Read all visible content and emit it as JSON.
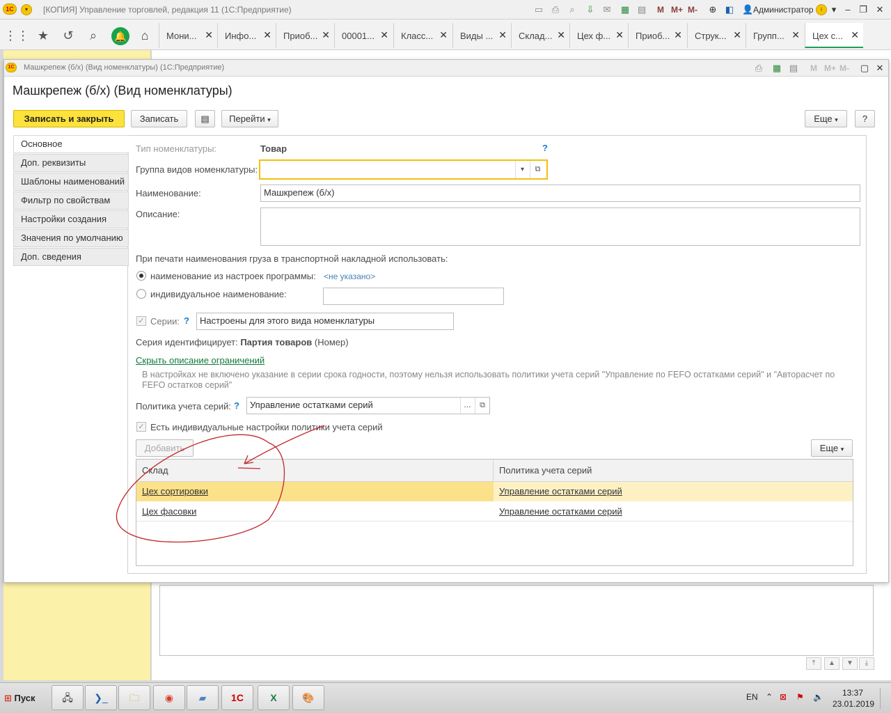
{
  "app_title": "[КОПИЯ] Управление торговлей, редакция 11  (1С:Предприятие)",
  "user": "Администратор",
  "toolbar_letters": [
    "M",
    "M+",
    "M-"
  ],
  "tabs": [
    "Мони...",
    "Инфо...",
    "Приоб...",
    "00001...",
    "Класс...",
    "Виды ...",
    "Склад...",
    "Цех ф...",
    "Приоб...",
    "Струк...",
    "Групп...",
    "Цех с..."
  ],
  "form": {
    "window_title": "Машкрепеж (б/х) (Вид номенклатуры)  (1С:Предприятие)",
    "toolbar_letters": [
      "M",
      "M+",
      "M-"
    ],
    "heading": "Машкрепеж (б/х) (Вид номенклатуры)",
    "buttons": {
      "save_close": "Записать и закрыть",
      "save": "Записать",
      "goto": "Перейти",
      "more": "Еще",
      "help": "?"
    },
    "nav": [
      "Основное",
      "Доп. реквизиты",
      "Шаблоны наименований",
      "Фильтр по свойствам",
      "Настройки создания",
      "Значения по умолчанию",
      "Доп. сведения"
    ],
    "fields": {
      "type_label": "Тип номенклатуры:",
      "type_value": "Товар",
      "help_mark": "?",
      "group_label": "Группа видов номенклатуры:",
      "group_value": "",
      "name_label": "Наименование:",
      "name_value": "Машкрепеж (б/х)",
      "desc_label": "Описание:",
      "desc_value": ""
    },
    "print": {
      "heading": "При печати наименования груза в транспортной накладной использовать:",
      "opt1": "наименование из настроек программы:",
      "opt1_value": "<не указано>",
      "opt2": "индивидуальное наименование:",
      "opt2_value": ""
    },
    "series": {
      "label": "Серии:",
      "help": "?",
      "value": "Настроены для этого вида номенклатуры",
      "identifies_label": "Серия идентифицирует:",
      "identifies_bold": "Партия товаров",
      "identifies_suffix": "(Номер)",
      "hide_link": "Скрыть описание ограничений",
      "note": "В настройках не включено указание в серии срока годности, поэтому нельзя использовать политики учета серий \"Управление по FEFO остатками серий\" и \"Авторасчет по FEFO остатков серий\"",
      "policy_label": "Политика учета серий:",
      "policy_help": "?",
      "policy_value": "Управление остатками серий",
      "individual_label": "Есть индивидуальные настройки политики учета серий",
      "add_button": "Добавить",
      "more_button": "Еще"
    },
    "table": {
      "headers": [
        "Склад",
        "Политика учета серий"
      ],
      "rows": [
        {
          "warehouse": "Цех сортировки",
          "policy": "Управление остатками серий"
        },
        {
          "warehouse": "Цех фасовки",
          "policy": "Управление остатками серий"
        }
      ]
    }
  },
  "taskbar": {
    "start": "Пуск",
    "lang": "EN",
    "time": "13:37",
    "date": "23.01.2019"
  }
}
